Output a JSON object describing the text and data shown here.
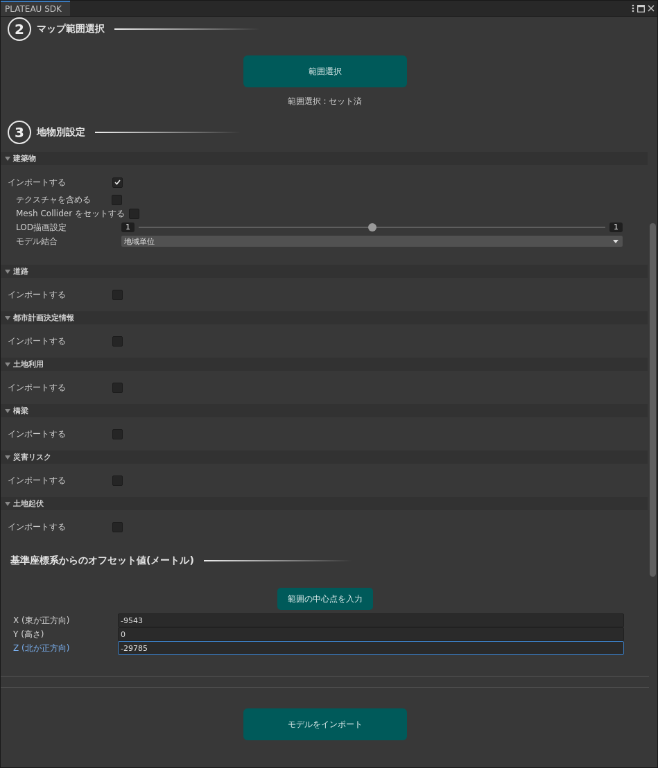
{
  "window": {
    "tab": "PLATEAU SDK",
    "selected": true
  },
  "step_area": {
    "step": "2",
    "title": "マップ範囲選択",
    "button": "範囲選択",
    "status": "範囲選択 : セット済"
  },
  "step_features": {
    "step": "3",
    "title": "地物別設定"
  },
  "categories": [
    {
      "name": "建築物",
      "expanded": true,
      "import_label": "インポートする",
      "import_checked": true,
      "options": [
        {
          "kind": "checkbox",
          "label": "テクスチャを含める",
          "checked": false
        },
        {
          "kind": "checkbox",
          "label": "Mesh Collider をセットする",
          "checked": false
        },
        {
          "kind": "slider",
          "label": "LOD描画設定",
          "min": "1",
          "max": "1",
          "level": 0.5
        },
        {
          "kind": "dropdown",
          "label": "モデル結合",
          "value": "地域単位"
        }
      ]
    },
    {
      "name": "道路",
      "expanded": true,
      "import_label": "インポートする",
      "import_checked": false
    },
    {
      "name": "都市計画決定情報",
      "expanded": true,
      "import_label": "インポートする",
      "import_checked": false
    },
    {
      "name": "土地利用",
      "expanded": true,
      "import_label": "インポートする",
      "import_checked": false
    },
    {
      "name": "橋梁",
      "expanded": true,
      "import_label": "インポートする",
      "import_checked": false
    },
    {
      "name": "災害リスク",
      "expanded": true,
      "import_label": "インポートする",
      "import_checked": false
    },
    {
      "name": "土地起伏",
      "expanded": true,
      "import_label": "インポートする",
      "import_checked": false
    }
  ],
  "offset": {
    "title": "基準座標系からのオフセット値(メートル)",
    "button": "範囲の中心点を入力",
    "fields": [
      {
        "label": "X (東が正方向)",
        "value": "-9543",
        "focused": false
      },
      {
        "label": "Y (高さ)",
        "value": "0",
        "focused": false
      },
      {
        "label": "Z (北が正方向)",
        "value": "-29785",
        "focused": true
      }
    ]
  },
  "import_button": "モデルをインポート"
}
